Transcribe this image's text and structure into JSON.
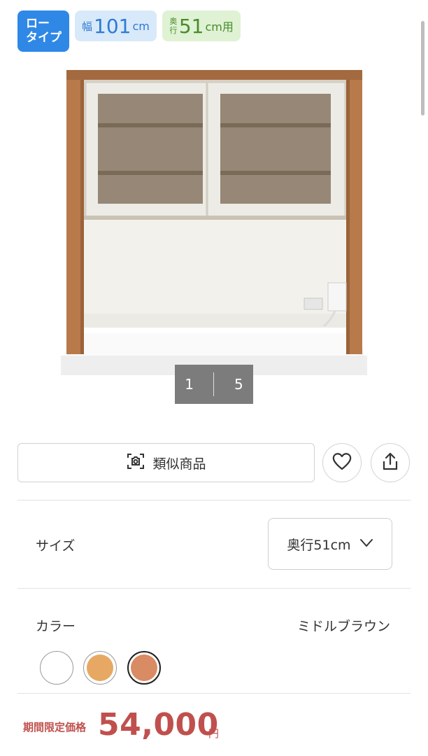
{
  "tags": {
    "low_type_line1": "ロー",
    "low_type_line2": "タイプ",
    "width_prefix": "幅",
    "width_value": "101",
    "width_unit": "cm",
    "depth_prefix_top": "奥",
    "depth_prefix_bottom": "行",
    "depth_value": "51",
    "depth_unit": "cm用"
  },
  "gallery": {
    "current": "1",
    "total": "5"
  },
  "actions": {
    "similar_label": "類似商品",
    "similar_icon": "camera-scan-icon",
    "favorite_icon": "heart-icon",
    "share_icon": "share-icon"
  },
  "size": {
    "label": "サイズ",
    "selected": "奥行51cm",
    "chevron_icon": "chevron-down-icon"
  },
  "color": {
    "label": "カラー",
    "selected_name": "ミドルブラウン",
    "swatches": [
      {
        "color": "#ffffff",
        "selected": false
      },
      {
        "color": "#e6a862",
        "selected": false
      },
      {
        "color": "#d98b63",
        "selected": true
      }
    ]
  },
  "price": {
    "label": "期間限定価格",
    "value": "54,000",
    "unit": "円",
    "color": "#c0504d"
  },
  "colors": {
    "accent_blue": "#2f88e6",
    "cabinet_wood": "#b87a4b"
  }
}
